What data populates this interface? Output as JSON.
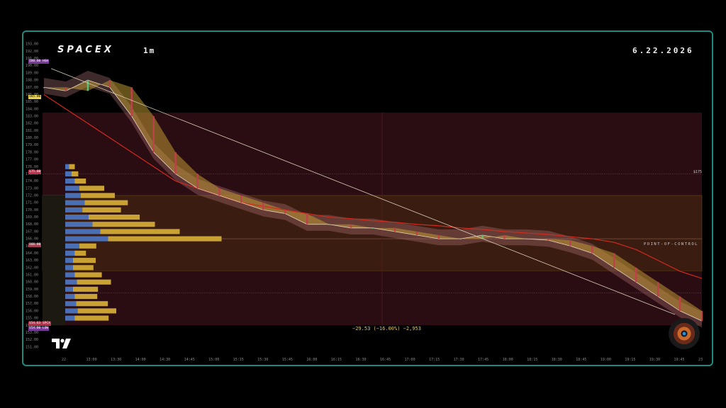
{
  "header": {
    "brand": "SPACEX",
    "interval": "1m",
    "date": "6.22.2026"
  },
  "annotations": {
    "poc": "POINT-OF-CONTROL",
    "right_level_tag": "$175",
    "measure": "−29.53 (−16.00%) −2,953"
  },
  "price_labels": {
    "top": "180.00",
    "top_tag": "HGH",
    "mid": "165.00",
    "red": "175.00",
    "poc": "166.00",
    "low1": "154.63",
    "low1_tag": "SPCX",
    "low2": "154.00",
    "low2_tag": "LOW"
  },
  "colors": {
    "accent_border": "#1d8a7f",
    "up_zone": "#3a1c10",
    "down_zone": "#2a0d12",
    "vwap": "#d4291f",
    "fill_gold": "#c9a233",
    "fill_rose": "#b5787a",
    "profile_blue": "#4a6fb5",
    "profile_gold": "#c9a233"
  },
  "chart_data": {
    "type": "line",
    "title": "SPACEX",
    "xlabel": "",
    "ylabel": "",
    "ylim": [
      150,
      194
    ],
    "y_ticks": [
      "193.00",
      "192.00",
      "191.00",
      "190.00",
      "189.00",
      "188.00",
      "187.00",
      "186.00",
      "185.00",
      "184.00",
      "183.00",
      "182.00",
      "181.00",
      "180.00",
      "179.00",
      "178.00",
      "177.00",
      "176.00",
      "175.00",
      "174.00",
      "173.00",
      "172.00",
      "171.00",
      "170.00",
      "169.00",
      "168.00",
      "167.00",
      "166.00",
      "165.00",
      "164.00",
      "163.00",
      "162.00",
      "161.00",
      "160.00",
      "159.00",
      "158.00",
      "157.00",
      "156.00",
      "155.00",
      "154.00",
      "153.00",
      "152.00",
      "151.00"
    ],
    "x_ticks": [
      "22",
      "13:00",
      "13:30",
      "14:00",
      "14:30",
      "14:45",
      "15:00",
      "15:15",
      "15:30",
      "15:45",
      "16:00",
      "16:15",
      "16:30",
      "16:45",
      "17:00",
      "17:15",
      "17:30",
      "17:45",
      "18:00",
      "18:15",
      "18:30",
      "18:45",
      "19:00",
      "19:15",
      "19:30",
      "19:45",
      "23"
    ],
    "series": [
      {
        "values": [
          187,
          186.5,
          188,
          187,
          183,
          178,
          175,
          173,
          172,
          171,
          170,
          169.5,
          168,
          168,
          167.5,
          167.5,
          167,
          166.5,
          166,
          166,
          166.5,
          166,
          166,
          165.8,
          165,
          164,
          162,
          160,
          158,
          156,
          154.6
        ]
      }
    ],
    "vwap_values": [
      186,
      184,
      182,
      180,
      178,
      176,
      174,
      173,
      172,
      171,
      170.5,
      170,
      169.5,
      169,
      168.8,
      168.5,
      168.3,
      168,
      167.8,
      167.5,
      167.3,
      167,
      166.8,
      166.6,
      166.3,
      166,
      165.5,
      164.5,
      163,
      161.5,
      160.5
    ],
    "trendline": {
      "from": 189.6,
      "to": 155.5
    },
    "value_area": {
      "high": 172.0,
      "low": 161.5
    },
    "poc_price": 166.0,
    "level_175": 175.0,
    "zone_top": 183.5,
    "volume_profile": [
      {
        "price": 176,
        "blue": 0.05,
        "gold": 0.05
      },
      {
        "price": 175,
        "blue": 0.08,
        "gold": 0.06
      },
      {
        "price": 174,
        "blue": 0.12,
        "gold": 0.1
      },
      {
        "price": 173,
        "blue": 0.18,
        "gold": 0.22
      },
      {
        "price": 172,
        "blue": 0.2,
        "gold": 0.3
      },
      {
        "price": 171,
        "blue": 0.25,
        "gold": 0.38
      },
      {
        "price": 170,
        "blue": 0.22,
        "gold": 0.34
      },
      {
        "price": 169,
        "blue": 0.3,
        "gold": 0.45
      },
      {
        "price": 168,
        "blue": 0.35,
        "gold": 0.55
      },
      {
        "price": 167,
        "blue": 0.45,
        "gold": 0.7
      },
      {
        "price": 166,
        "blue": 0.55,
        "gold": 1.0
      },
      {
        "price": 165,
        "blue": 0.18,
        "gold": 0.15
      },
      {
        "price": 164,
        "blue": 0.12,
        "gold": 0.1
      },
      {
        "price": 163,
        "blue": 0.1,
        "gold": 0.2
      },
      {
        "price": 162,
        "blue": 0.1,
        "gold": 0.18
      },
      {
        "price": 161,
        "blue": 0.12,
        "gold": 0.24
      },
      {
        "price": 160,
        "blue": 0.15,
        "gold": 0.3
      },
      {
        "price": 159,
        "blue": 0.1,
        "gold": 0.22
      },
      {
        "price": 158,
        "blue": 0.12,
        "gold": 0.2
      },
      {
        "price": 157,
        "blue": 0.14,
        "gold": 0.28
      },
      {
        "price": 156,
        "blue": 0.16,
        "gold": 0.34
      },
      {
        "price": 155,
        "blue": 0.12,
        "gold": 0.3
      }
    ]
  }
}
